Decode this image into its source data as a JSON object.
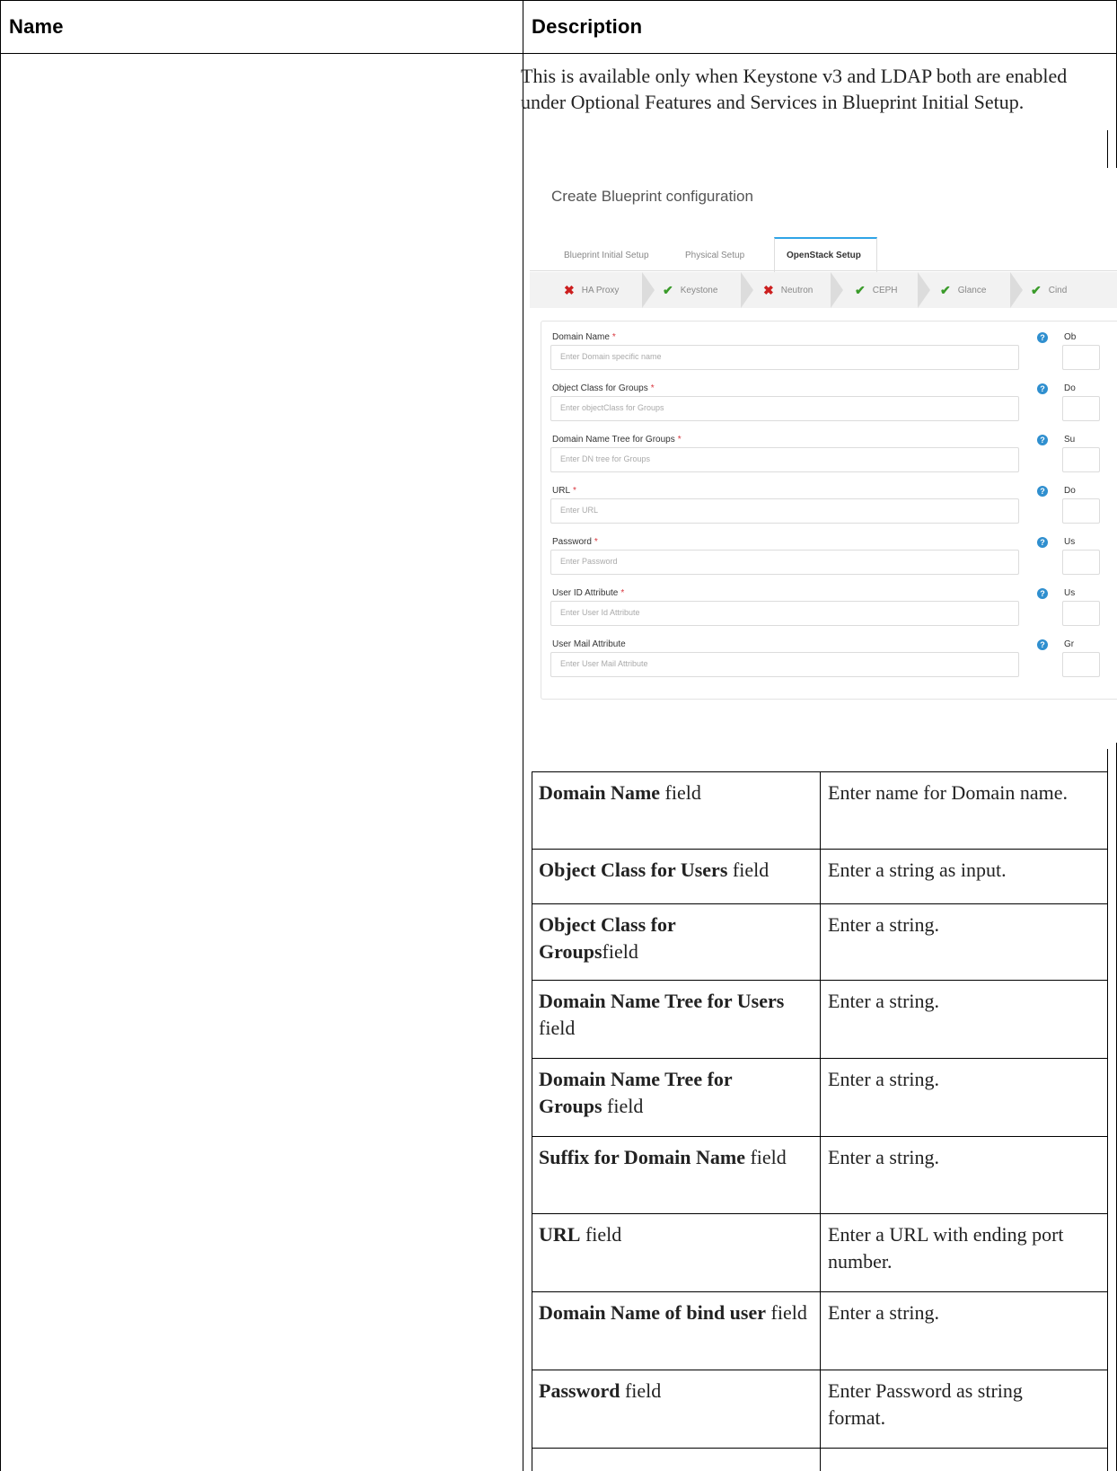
{
  "header": {
    "name_col": "Name",
    "desc_col": "Description"
  },
  "description": "This is available only when Keystone v3 and LDAP both are enabled under Optional Features and Services in Blueprint Initial Setup.",
  "screenshot": {
    "title": "Create Blueprint configuration",
    "tabs": [
      "Blueprint Initial Setup",
      "Physical Setup",
      "OpenStack Setup"
    ],
    "active_tab": "OpenStack Setup",
    "steps": [
      {
        "label": "HA Proxy",
        "status": "error"
      },
      {
        "label": "Keystone",
        "status": "ok"
      },
      {
        "label": "Neutron",
        "status": "error"
      },
      {
        "label": "CEPH",
        "status": "ok"
      },
      {
        "label": "Glance",
        "status": "ok"
      },
      {
        "label": "Cind",
        "status": "ok"
      }
    ],
    "fields": [
      {
        "label": "Domain Name",
        "required": "*",
        "placeholder": "Enter Domain specific name",
        "right": "Ob"
      },
      {
        "label": "Object Class for Groups",
        "required": "*",
        "placeholder": "Enter objectClass for Groups",
        "right": "Do"
      },
      {
        "label": "Domain Name Tree for Groups",
        "required": "*",
        "placeholder": "Enter DN tree for Groups",
        "right": "Su"
      },
      {
        "label": "URL",
        "required": "*",
        "placeholder": "Enter URL",
        "right": "Do"
      },
      {
        "label": "Password",
        "required": "*",
        "placeholder": "Enter Password",
        "right": "Us"
      },
      {
        "label": "User ID Attribute",
        "required": "*",
        "placeholder": "Enter User Id Attribute",
        "right": "Us"
      },
      {
        "label": "User Mail Attribute",
        "required": "",
        "placeholder": "Enter User Mail Attribute",
        "right": "Gr"
      }
    ],
    "colors": {
      "error": "#cc1f1f",
      "ok": "#3a9b2a",
      "accent": "#2fa4e7",
      "info": "#2f8fcf"
    },
    "icons": {
      "error": "x-icon",
      "ok": "check-icon",
      "info": "info-icon"
    }
  },
  "rows": [
    {
      "name_bold": "Domain Name",
      "name_rest": " field",
      "desc": "Enter name for Domain name."
    },
    {
      "name_bold": "Object Class for Users",
      "name_rest": " field",
      "desc": "Enter a string as input."
    },
    {
      "name_bold": "Object Class for Groups",
      "name_rest": "field",
      "desc": "Enter a string."
    },
    {
      "name_bold": "Domain Name Tree for Users",
      "name_rest": " field",
      "desc": "Enter a string."
    },
    {
      "name_bold": "Domain Name Tree for Groups",
      "name_rest": " field",
      "desc": "Enter a string."
    },
    {
      "name_bold": "Suffix for Domain Name",
      "name_rest": " field",
      "desc": "Enter a string."
    },
    {
      "name_bold": "URL",
      "name_rest": " field",
      "desc": "Enter a URL with ending port number."
    },
    {
      "name_bold": "Domain Name of bind user",
      "name_rest": " field",
      "desc": "Enter a string."
    },
    {
      "name_bold": "Password",
      "name_rest": " field",
      "desc": "Enter Password as string format."
    }
  ]
}
